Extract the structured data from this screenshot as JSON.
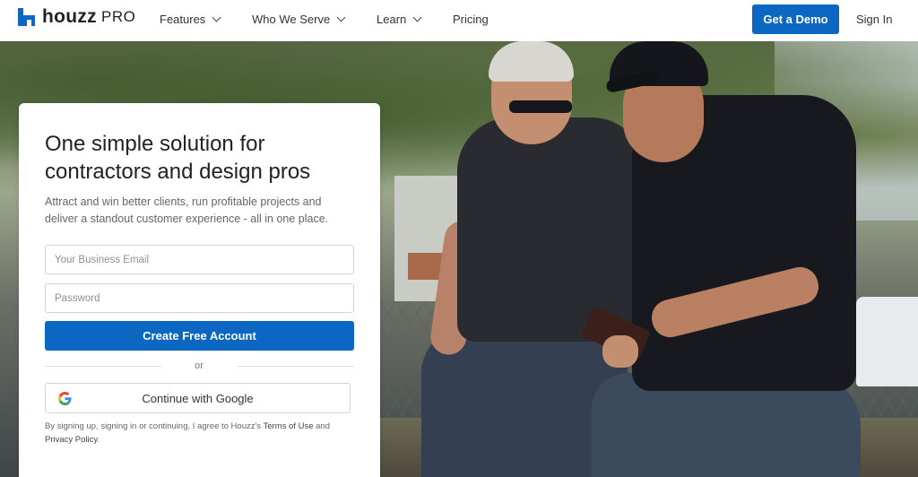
{
  "brand": {
    "logo_text": "houzz",
    "logo_suffix": "PRO",
    "accent_color": "#0b67c2"
  },
  "nav": {
    "items": [
      {
        "label": "Features",
        "has_dropdown": true
      },
      {
        "label": "Who We Serve",
        "has_dropdown": true
      },
      {
        "label": "Learn",
        "has_dropdown": true
      },
      {
        "label": "Pricing",
        "has_dropdown": false
      }
    ],
    "demo_label": "Get a Demo",
    "signin_label": "Sign In"
  },
  "signup": {
    "headline": "One simple solution for contractors and design pros",
    "subtext": "Attract and win better clients, run profitable projects and deliver a standout customer experience - all in one place.",
    "email_placeholder": "Your Business Email",
    "password_placeholder": "Password",
    "create_label": "Create Free Account",
    "or_label": "or",
    "google_label": "Continue with Google",
    "legal_prefix": "By signing up, signing in or continuing, I agree to Houzz's ",
    "terms_label": "Terms of Use",
    "legal_and": " and ",
    "privacy_label": "Privacy Policy",
    "legal_suffix": "."
  },
  "icons": {
    "logo": "houzz-logo-icon",
    "chevron": "chevron-down-icon",
    "google": "google-g-icon"
  }
}
